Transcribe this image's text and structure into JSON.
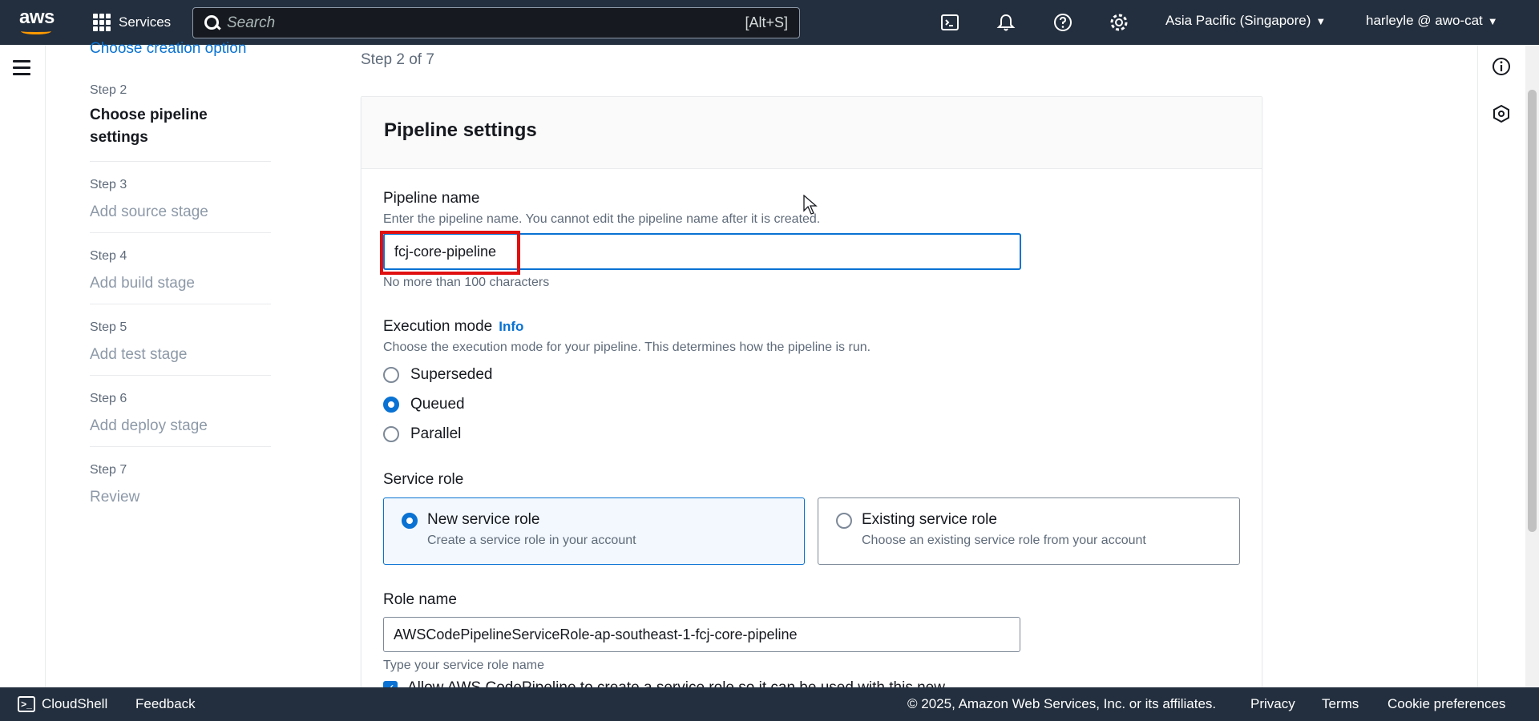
{
  "topnav": {
    "logo_text": "aws",
    "services_label": "Services",
    "search_placeholder": "Search",
    "search_shortcut": "[Alt+S]",
    "region": "Asia Pacific (Singapore)",
    "account": "harleyle @ awo-cat",
    "icons": [
      "cloudshell-icon",
      "bell-icon",
      "help-icon",
      "settings-icon"
    ]
  },
  "steps": {
    "prev_link": "Choose creation option",
    "items": [
      {
        "num": "Step 2",
        "title": "Choose pipeline settings"
      },
      {
        "num": "Step 3",
        "title": "Add source stage"
      },
      {
        "num": "Step 4",
        "title": "Add build stage"
      },
      {
        "num": "Step 5",
        "title": "Add test stage"
      },
      {
        "num": "Step 6",
        "title": "Add deploy stage"
      },
      {
        "num": "Step 7",
        "title": "Review"
      }
    ]
  },
  "page": {
    "step_of": "Step 2 of 7",
    "panel_title": "Pipeline settings"
  },
  "pipeline_name": {
    "label": "Pipeline name",
    "description": "Enter the pipeline name. You cannot edit the pipeline name after it is created.",
    "value": "fcj-core-pipeline",
    "constraint": "No more than 100 characters"
  },
  "execution_mode": {
    "label": "Execution mode",
    "info": "Info",
    "description": "Choose the execution mode for your pipeline. This determines how the pipeline is run.",
    "options": [
      "Superseded",
      "Queued",
      "Parallel"
    ],
    "selected": "Queued"
  },
  "service_role": {
    "label": "Service role",
    "new": {
      "title": "New service role",
      "desc": "Create a service role in your account"
    },
    "existing": {
      "title": "Existing service role",
      "desc": "Choose an existing service role from your account"
    },
    "selected": "New service role"
  },
  "role_name": {
    "label": "Role name",
    "value": "AWSCodePipelineServiceRole-ap-southeast-1-fcj-core-pipeline",
    "hint": "Type your service role name",
    "checkbox_label": "Allow AWS CodePipeline to create a service role so it can be used with this new"
  },
  "footer": {
    "cloudshell": "CloudShell",
    "feedback": "Feedback",
    "copyright": "© 2025, Amazon Web Services, Inc. or its affiliates.",
    "privacy": "Privacy",
    "terms": "Terms",
    "cookies": "Cookie preferences"
  },
  "colors": {
    "nav_bg": "#232f3e",
    "accent": "#0972d3",
    "highlight": "#e01010",
    "brand_orange": "#ff9900"
  }
}
